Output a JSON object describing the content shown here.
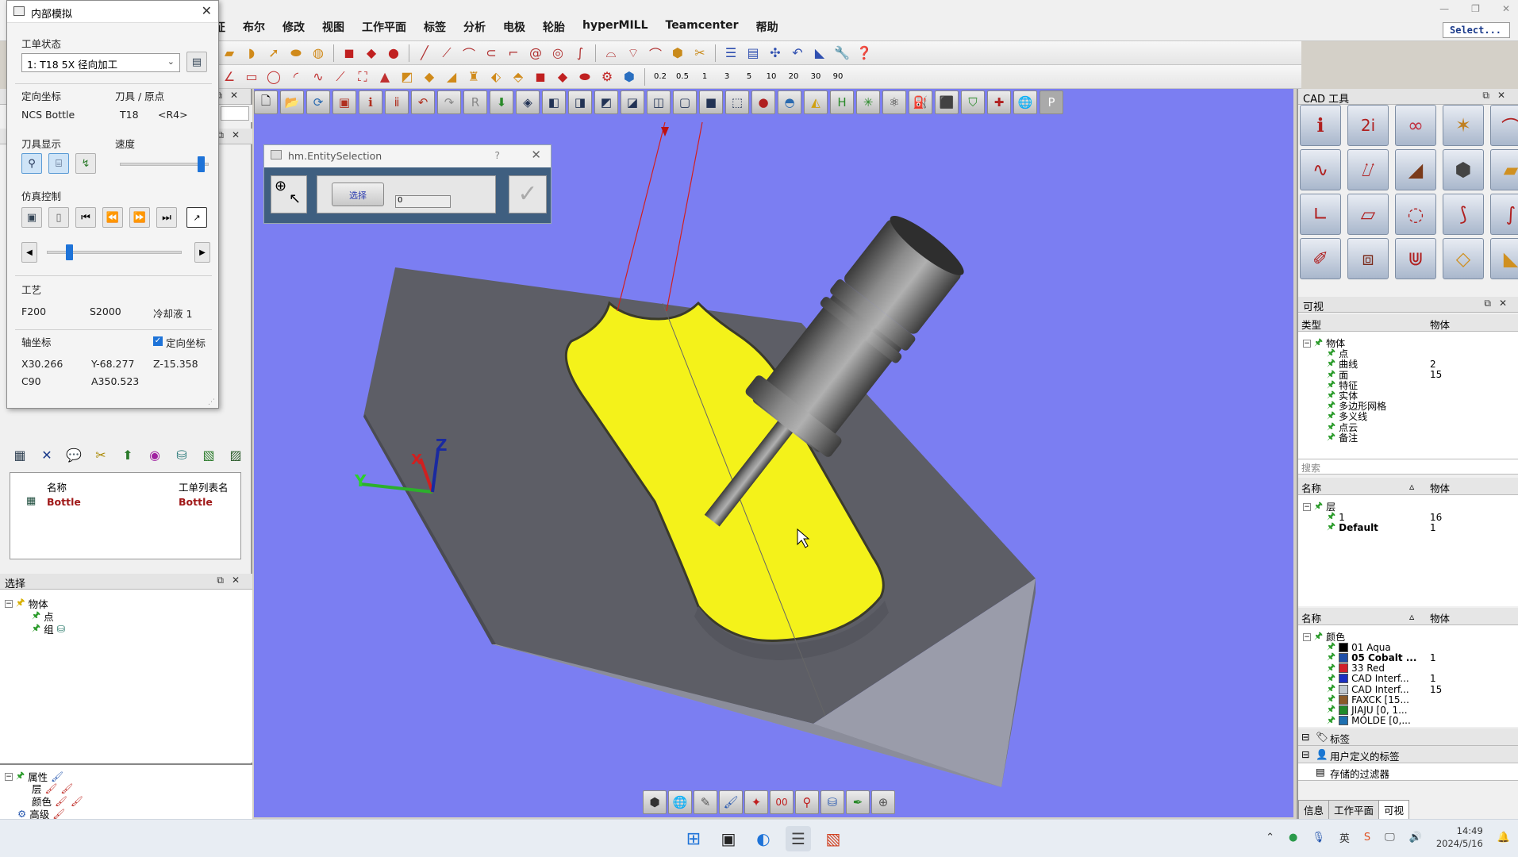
{
  "menubar": {
    "items": [
      "征",
      "布尔",
      "修改",
      "视图",
      "工作平面",
      "标签",
      "分析",
      "电极",
      "轮胎",
      "hyperMILL",
      "Teamcenter",
      "帮助"
    ],
    "select_label": "Select..."
  },
  "sim_dialog": {
    "title": "内部模拟",
    "job_state_label": "工单状态",
    "job_state_value": "1: T18 5X 径向加工",
    "frame_label": "定向坐标",
    "frame_value": "NCS Bottle",
    "tool_origin_label": "刀具 / 原点",
    "tool_value": "T18",
    "origin_value": "<R4>",
    "tool_display_label": "刀具显示",
    "speed_label": "速度",
    "speed_level": 0.95,
    "sim_control_label": "仿真控制",
    "progress_level": 0.15,
    "process_label": "工艺",
    "feed": "F200",
    "spindle": "S2000",
    "coolant": "冷却液 1",
    "axis_label": "轴坐标",
    "oriented_check_label": "定向坐标",
    "x": "X30.266",
    "y": "Y-68.277",
    "z": "Z-15.358",
    "c": "C90",
    "a": "A350.523"
  },
  "ops_table": {
    "col_name": "名称",
    "col_list": "工单列表名",
    "rows": [
      {
        "name": "Bottle",
        "list": "Bottle"
      }
    ]
  },
  "selection_panel": {
    "title": "选择",
    "root": "物体",
    "children": [
      "点",
      "组"
    ]
  },
  "attr_panel": {
    "items": [
      "属性",
      "层",
      "颜色",
      "高级"
    ]
  },
  "entity_dialog": {
    "title": "hm.EntitySelection",
    "help": "?",
    "select_button": "选择",
    "count": "0"
  },
  "right_dock": {
    "cad_title": "CAD 工具",
    "visible_title": "可视",
    "col_type": "类型",
    "col_obj": "物体",
    "type_tree": [
      {
        "label": "物体",
        "count": ""
      },
      {
        "label": "点",
        "count": ""
      },
      {
        "label": "曲线",
        "count": "2"
      },
      {
        "label": "面",
        "count": "15"
      },
      {
        "label": "特征",
        "count": ""
      },
      {
        "label": "实体",
        "count": ""
      },
      {
        "label": "多边形网格",
        "count": ""
      },
      {
        "label": "多义线",
        "count": ""
      },
      {
        "label": "点云",
        "count": ""
      },
      {
        "label": "备注",
        "count": ""
      }
    ],
    "search_placeholder": "搜索",
    "col_name": "名称",
    "layers": [
      {
        "label": "层",
        "count": ""
      },
      {
        "label": "1",
        "count": "16"
      },
      {
        "label": "Default",
        "count": "1"
      }
    ],
    "colors": [
      {
        "label": "颜色",
        "count": "",
        "color": ""
      },
      {
        "label": "01 Aqua",
        "count": "",
        "color": "#000000"
      },
      {
        "label": "05 Cobalt ...",
        "count": "1",
        "color": "#1f4fa8"
      },
      {
        "label": "33 Red",
        "count": "",
        "color": "#d0202a"
      },
      {
        "label": "CAD Interf...",
        "count": "1",
        "color": "#1a2ec2"
      },
      {
        "label": "CAD Interf...",
        "count": "15",
        "color": "#c0c8d0"
      },
      {
        "label": "FAXCK [15...",
        "count": "",
        "color": "#8a5a2a"
      },
      {
        "label": "JIAJU [0, 1...",
        "count": "",
        "color": "#208a2a"
      },
      {
        "label": "MOLDE [0,...",
        "count": "",
        "color": "#1e6fb0"
      }
    ],
    "tags_label": "标签",
    "user_tags_label": "用户定义的标签",
    "saved_filters_label": "存储的过滤器",
    "tabs": [
      "信息",
      "工作平面",
      "可视"
    ]
  },
  "viewport": {
    "axis_x": "X",
    "axis_y": "Y",
    "axis_z": "Z",
    "bg_color": "#7b7ef2",
    "part_color": "#f4f21a"
  },
  "taskbar": {
    "time": "14:49",
    "date": "2024/5/16"
  }
}
